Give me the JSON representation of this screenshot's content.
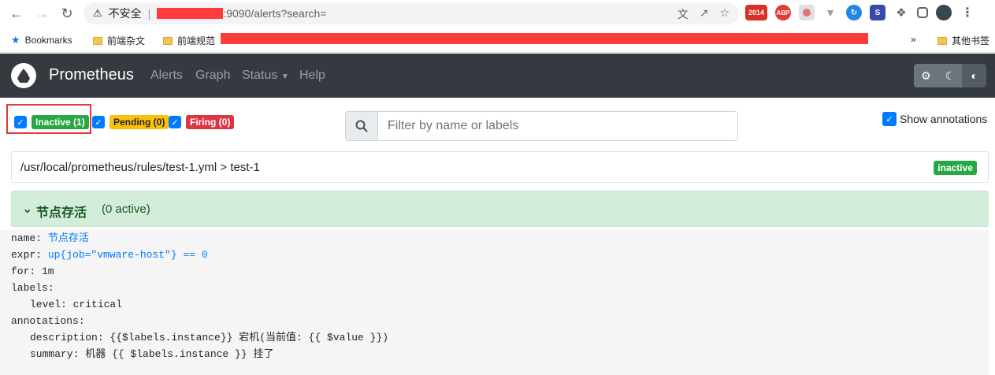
{
  "browser": {
    "insecure_label": "不安全",
    "url": ":9090/alerts?search=",
    "ext_badge": "2014",
    "ext_abp": "ABP",
    "bookmarks": [
      {
        "label": "Bookmarks"
      },
      {
        "label": "前端杂文"
      },
      {
        "label": "前端规范"
      }
    ],
    "bookmarks_more": "»",
    "bookmarks_other": "其他书签"
  },
  "navbar": {
    "brand": "Prometheus",
    "links": [
      "Alerts",
      "Graph",
      "Status",
      "Help"
    ]
  },
  "filters": {
    "inactive": "Inactive (1)",
    "pending": "Pending (0)",
    "firing": "Firing (0)",
    "search_placeholder": "Filter by name or labels",
    "show_annotations": "Show annotations"
  },
  "rule_file": {
    "path": "/usr/local/prometheus/rules/test-1.yml > test-1",
    "state": "inactive"
  },
  "alert": {
    "name": "节点存活",
    "active_count": "(0 active)",
    "rule": {
      "name_key": "name: ",
      "name_val": "节点存活",
      "expr_key": "expr: ",
      "expr_val": "up{job=\"vmware-host\"} == 0",
      "for_line": "for: 1m",
      "labels_line": "labels:",
      "level_line": "level: critical",
      "annotations_line": "annotations:",
      "description_line": "description: {{$labels.instance}} 宕机(当前值: {{ $value }})",
      "summary_line": "summary: 机器 {{ $labels.instance }} 挂了"
    }
  },
  "colors": {
    "navbar_bg": "#343a40",
    "success": "#28a745",
    "warning": "#ffc107",
    "danger": "#dc3545",
    "primary": "#007bff",
    "alert_bg": "#d4edda",
    "highlight": "#e53935"
  }
}
